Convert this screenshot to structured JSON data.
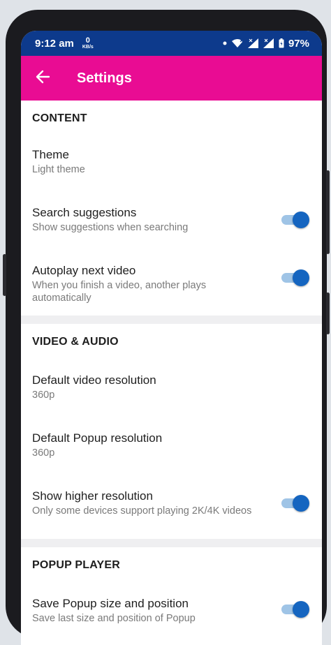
{
  "status_bar": {
    "time": "9:12 am",
    "net_speed_value": "0",
    "net_speed_unit": "KB/s",
    "battery": "97%",
    "icons": [
      "dot-icon",
      "wifi-icon",
      "signal-icon",
      "signal-icon",
      "battery-icon"
    ]
  },
  "app_bar": {
    "title": "Settings",
    "back_icon": "arrow-left-icon",
    "color": "#e90c93"
  },
  "sections": [
    {
      "title": "CONTENT",
      "items": [
        {
          "title": "Theme",
          "subtitle": "Light theme",
          "toggle": null
        },
        {
          "title": "Search suggestions",
          "subtitle": "Show suggestions when searching",
          "toggle": true
        },
        {
          "title": "Autoplay next video",
          "subtitle": "When you finish a video, another plays automatically",
          "toggle": true
        }
      ]
    },
    {
      "title": "VIDEO & AUDIO",
      "items": [
        {
          "title": "Default video resolution",
          "subtitle": "360p",
          "toggle": null
        },
        {
          "title": "Default Popup resolution",
          "subtitle": "360p",
          "toggle": null
        },
        {
          "title": "Show higher resolution",
          "subtitle": "Only some devices support playing 2K/4K videos",
          "toggle": true
        }
      ]
    },
    {
      "title": "POPUP PLAYER",
      "items": [
        {
          "title": "Save Popup size and position",
          "subtitle": "Save last size and position of Popup",
          "toggle": true
        }
      ]
    }
  ],
  "colors": {
    "status_bar": "#0d3a8c",
    "toggle_knob": "#1565c0",
    "toggle_track": "#9fc4e6"
  }
}
